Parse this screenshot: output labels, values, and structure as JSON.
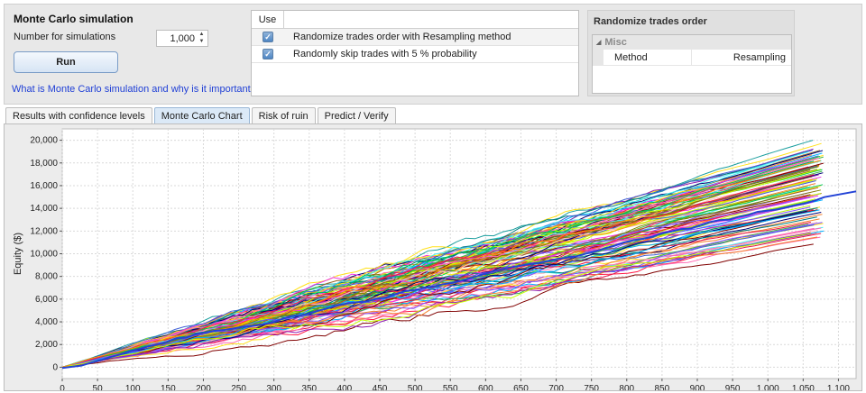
{
  "monte_carlo": {
    "title": "Monte Carlo simulation",
    "num_label": "Number for simulations",
    "num_value": "1,000",
    "run_label": "Run",
    "help_link": "What is Monte Carlo simulation and why is it important?"
  },
  "use_table": {
    "header": "Use",
    "rows": [
      {
        "checked": true,
        "label": "Randomize trades order with Resampling method"
      },
      {
        "checked": true,
        "label": "Randomly skip trades with 5 % probability"
      }
    ]
  },
  "randomize_panel": {
    "title": "Randomize trades order",
    "category": "Misc",
    "properties": [
      {
        "key": "Method",
        "value": "Resampling"
      }
    ]
  },
  "tabs": [
    {
      "label": "Results with confidence levels",
      "active": false
    },
    {
      "label": "Monte Carlo Chart",
      "active": true
    },
    {
      "label": "Risk of ruin",
      "active": false
    },
    {
      "label": "Predict / Verify",
      "active": false
    }
  ],
  "chart_data": {
    "type": "line",
    "ylabel": "Equity ($)",
    "xlabel": "",
    "xlim": [
      0,
      1125
    ],
    "ylim": [
      -1000,
      21000
    ],
    "x_ticks": [
      0,
      50,
      100,
      150,
      200,
      250,
      300,
      350,
      400,
      450,
      500,
      550,
      600,
      650,
      700,
      750,
      800,
      850,
      900,
      950,
      1000,
      1050,
      1100
    ],
    "x_tick_labels": [
      "0",
      "50",
      "100",
      "150",
      "200",
      "250",
      "300",
      "350",
      "400",
      "450",
      "500",
      "550",
      "600",
      "650",
      "700",
      "750",
      "800",
      "850",
      "900",
      "950",
      "1,000",
      "1,050",
      "1,100"
    ],
    "y_ticks": [
      0,
      2000,
      4000,
      6000,
      8000,
      10000,
      12000,
      14000,
      16000,
      18000,
      20000
    ],
    "y_tick_labels": [
      "0",
      "2,000",
      "4,000",
      "6,000",
      "8,000",
      "10,000",
      "12,000",
      "14,000",
      "16,000",
      "18,000",
      "20,000"
    ],
    "grid": true,
    "simulations": 1000,
    "trades": 1080,
    "final_equity_range": [
      10500,
      20000
    ],
    "original_series_final": 15500,
    "series_colors": [
      "#e6194b",
      "#3cb44b",
      "#ffe119",
      "#4363d8",
      "#f58231",
      "#911eb4",
      "#46f0f0",
      "#f032e6",
      "#bcf60c",
      "#fabebe",
      "#008080",
      "#9a6324",
      "#800000",
      "#808000",
      "#000075",
      "#ff69b4",
      "#00c853",
      "#00b0ff",
      "#ff1744",
      "#7c4dff",
      "#c6ff00",
      "#ff9100"
    ]
  }
}
